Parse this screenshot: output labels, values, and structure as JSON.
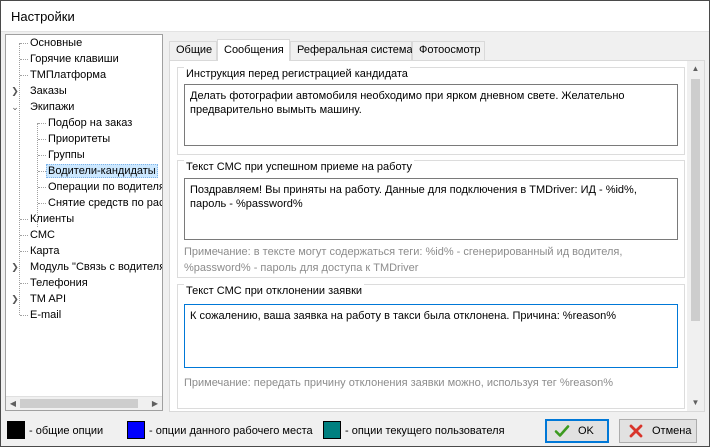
{
  "window": {
    "title": "Настройки"
  },
  "tree": {
    "items": [
      {
        "label": "Основные"
      },
      {
        "label": "Горячие клавиши"
      },
      {
        "label": "ТМПлатформа"
      },
      {
        "label": "Заказы"
      },
      {
        "label": "Экипажи"
      },
      {
        "label": "Подбор на заказ"
      },
      {
        "label": "Приоритеты"
      },
      {
        "label": "Группы"
      },
      {
        "label": "Водители-кандидаты"
      },
      {
        "label": "Операции по водителям"
      },
      {
        "label": "Снятие средств по расписанию"
      },
      {
        "label": "Клиенты"
      },
      {
        "label": "СМС"
      },
      {
        "label": "Карта"
      },
      {
        "label": "Модуль \"Связь с водителями\""
      },
      {
        "label": "Телефония"
      },
      {
        "label": "TM API"
      },
      {
        "label": "E-mail"
      }
    ]
  },
  "tabs": [
    {
      "label": "Общие"
    },
    {
      "label": "Сообщения"
    },
    {
      "label": "Реферальная система"
    },
    {
      "label": "Фотоосмотр"
    }
  ],
  "sections": [
    {
      "title": "Инструкция перед регистрацией кандидата",
      "value": "Делать фотографии автомобиля необходимо при ярком дневном свете. Желательно\nпредварительно вымыть машину."
    },
    {
      "title": "Текст СМС при успешном приеме на работу",
      "value": "Поздравляем! Вы приняты на работу. Данные для подключения в TMDriver: ИД - %id%,\nпароль - %password%",
      "note": "Примечание: в тексте могут содержаться теги: %id% - сгенерированный ид\nводителя, %password% - пароль для доступа к TMDriver"
    },
    {
      "title": "Текст СМС при отклонении заявки",
      "value": "К сожалению, ваша заявка на работу в такси была отклонена. Причина: %reason%",
      "note": "Примечание: передать причину отклонения заявки можно, используя тег\n%reason%"
    }
  ],
  "legend": [
    {
      "label": "- общие опции",
      "color": "#000000"
    },
    {
      "label": "- опции данного рабочего места",
      "color": "#0000ff"
    },
    {
      "label": "- опции текущего пользователя",
      "color": "#008080"
    }
  ],
  "buttons": {
    "ok": "OK",
    "cancel": "Отмена"
  }
}
